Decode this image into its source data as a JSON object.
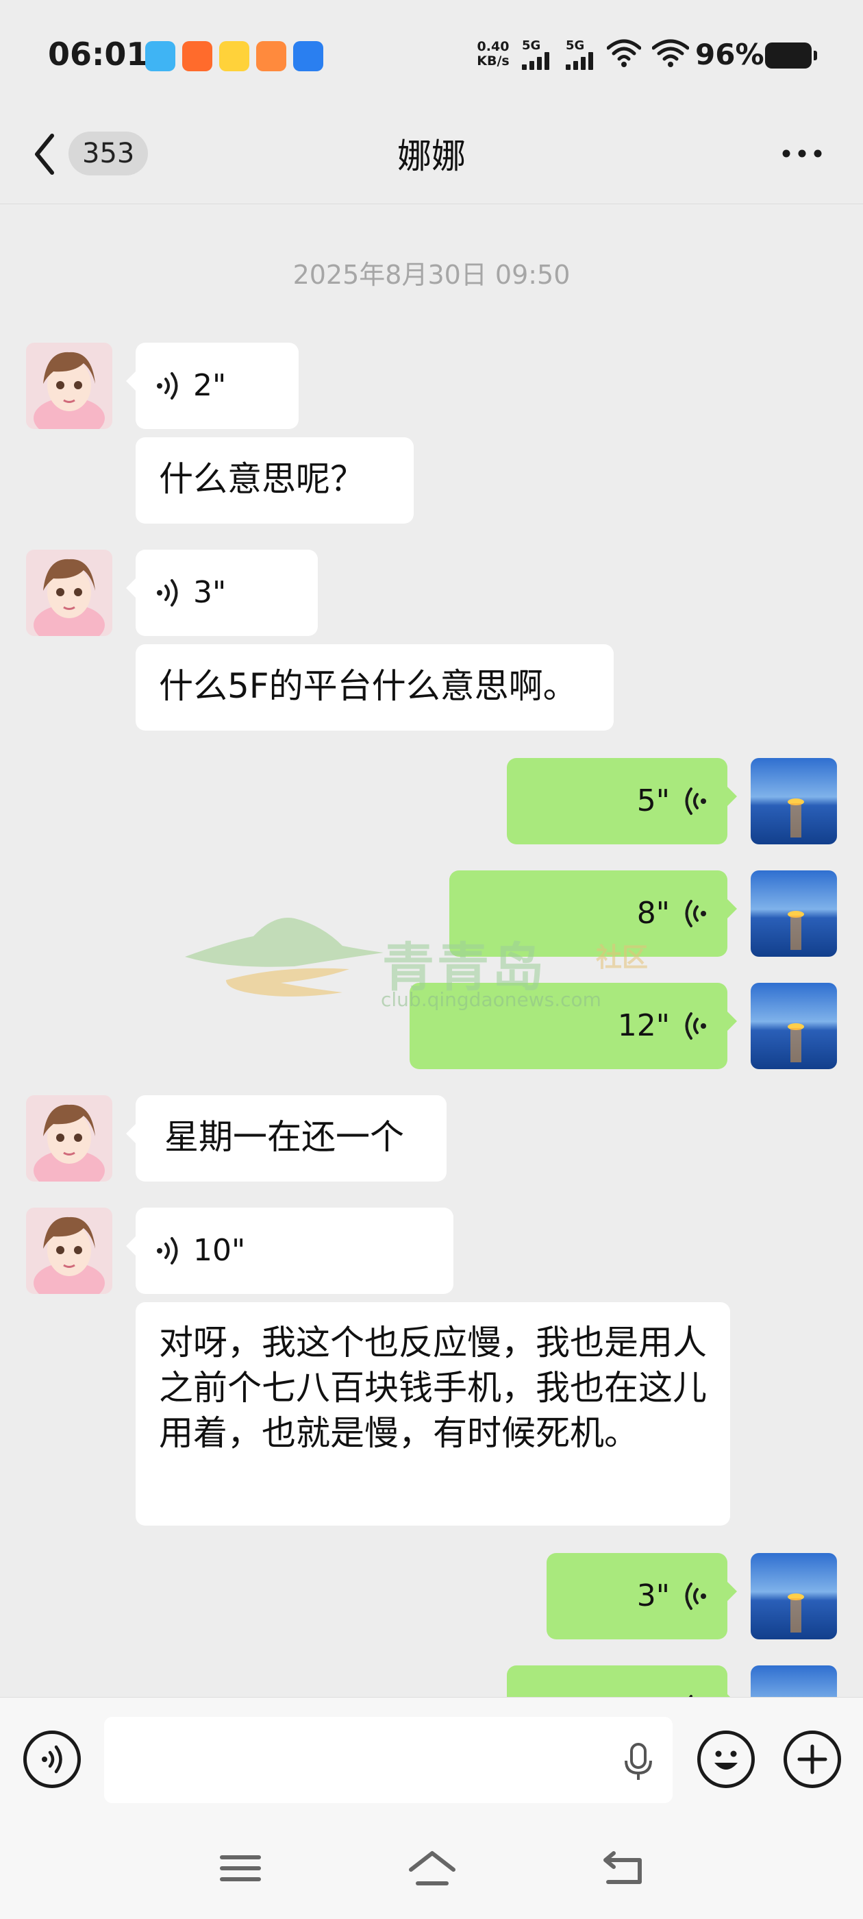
{
  "status_bar": {
    "time": "06:01",
    "net_speed_value": "0.40",
    "net_speed_unit": "KB/s",
    "sim1": "5G",
    "sim2": "5G",
    "battery": "96%"
  },
  "header": {
    "unread_count": "353",
    "title": "娜娜"
  },
  "chat": {
    "timestamp": "2025年8月30日 09:50",
    "messages": [
      {
        "side": "in",
        "type": "voice",
        "duration": "2\""
      },
      {
        "side": "in",
        "type": "text",
        "text": "什么意思呢？"
      },
      {
        "side": "in",
        "type": "voice",
        "duration": "3\""
      },
      {
        "side": "in",
        "type": "text",
        "text": "什么5F的平台什么意思啊。"
      },
      {
        "side": "out",
        "type": "voice",
        "duration": "5\""
      },
      {
        "side": "out",
        "type": "voice",
        "duration": "8\""
      },
      {
        "side": "out",
        "type": "voice",
        "duration": "12\""
      },
      {
        "side": "in",
        "type": "text",
        "text": "星期一在还一个"
      },
      {
        "side": "in",
        "type": "voice",
        "duration": "10\""
      },
      {
        "side": "in",
        "type": "text",
        "text": "对呀，我这个也反应慢，我也是用人之前个七八百块钱手机，我也在这儿用着，也就是慢，有时候死机。"
      },
      {
        "side": "out",
        "type": "voice",
        "duration": "3\""
      },
      {
        "side": "out",
        "type": "voice",
        "duration": ""
      }
    ]
  },
  "watermark": {
    "name": "青青岛",
    "sub": "社区",
    "url": "club.qingdaonews.com"
  },
  "colors": {
    "background": "#ededed",
    "incoming_bubble": "#ffffff",
    "outgoing_bubble": "#a9e97d"
  }
}
